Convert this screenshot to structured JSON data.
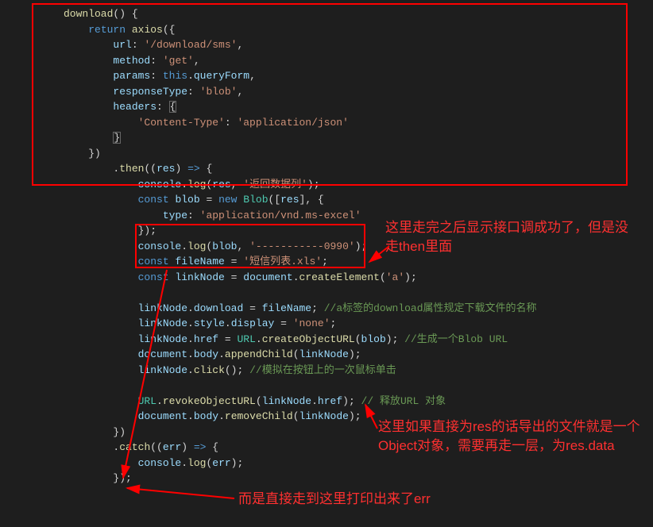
{
  "code": {
    "l1a": "download",
    "l1b": "() {",
    "l2a": "return",
    "l2b": "axios",
    "l2c": "({",
    "l3a": "url",
    "l3b": ": ",
    "l3c": "'/download/sms'",
    "l3d": ",",
    "l4a": "method",
    "l4b": ": ",
    "l4c": "'get'",
    "l4d": ",",
    "l5a": "params",
    "l5b": ": ",
    "l5c": "this",
    "l5d": ".",
    "l5e": "queryForm",
    "l5f": ",",
    "l6a": "responseType",
    "l6b": ": ",
    "l6c": "'blob'",
    "l6d": ",",
    "l7a": "headers",
    "l7b": ": ",
    "l7c": "{",
    "l8a": "'Content-Type'",
    "l8b": ": ",
    "l8c": "'application/json'",
    "l9a": "}",
    "l10a": "})",
    "l11a": ".",
    "l11b": "then",
    "l11c": "((",
    "l11d": "res",
    "l11e": ") ",
    "l11f": "=>",
    "l11g": " {",
    "l12a": "console",
    "l12b": ".",
    "l12c": "log",
    "l12d": "(",
    "l12e": "res",
    "l12f": ", ",
    "l12g": "'返回数据列'",
    "l12h": ");",
    "l13a": "const",
    "l13b": "blob",
    "l13c": " = ",
    "l13d": "new",
    "l13e": "Blob",
    "l13f": "([",
    "l13g": "res",
    "l13h": "], {",
    "l14a": "type",
    "l14b": ": ",
    "l14c": "'application/vnd.ms-excel'",
    "l15a": "});",
    "l16a": "console",
    "l16b": ".",
    "l16c": "log",
    "l16d": "(",
    "l16e": "blob",
    "l16f": ", ",
    "l16g": "'-----------0990'",
    "l16h": ");",
    "l17a": "const",
    "l17b": "fileName",
    "l17c": " = ",
    "l17d": "'短信列表.xls'",
    "l17e": ";",
    "l18a": "const",
    "l18b": "linkNode",
    "l18c": " = ",
    "l18d": "document",
    "l18e": ".",
    "l18f": "createElement",
    "l18g": "(",
    "l18h": "'a'",
    "l18i": ");",
    "l19a": "linkNode",
    "l19b": ".",
    "l19c": "download",
    "l19d": " = ",
    "l19e": "fileName",
    "l19f": "; ",
    "l19g": "//a标签的download属性规定下载文件的名称",
    "l20a": "linkNode",
    "l20b": ".",
    "l20c": "style",
    "l20d": ".",
    "l20e": "display",
    "l20f": " = ",
    "l20g": "'none'",
    "l20h": ";",
    "l21a": "linkNode",
    "l21b": ".",
    "l21c": "href",
    "l21d": " = ",
    "l21e": "URL",
    "l21f": ".",
    "l21g": "createObjectURL",
    "l21h": "(",
    "l21i": "blob",
    "l21j": "); ",
    "l21k": "//生成一个Blob URL",
    "l22a": "document",
    "l22b": ".",
    "l22c": "body",
    "l22d": ".",
    "l22e": "appendChild",
    "l22f": "(",
    "l22g": "linkNode",
    "l22h": ");",
    "l23a": "linkNode",
    "l23b": ".",
    "l23c": "click",
    "l23d": "(); ",
    "l23e": "//模拟在按钮上的一次鼠标单击",
    "l24a": "URL",
    "l24b": ".",
    "l24c": "revokeObjectURL",
    "l24d": "(",
    "l24e": "linkNode",
    "l24f": ".",
    "l24g": "href",
    "l24h": "); ",
    "l24i": "// 释放URL 对象",
    "l25a": "document",
    "l25b": ".",
    "l25c": "body",
    "l25d": ".",
    "l25e": "removeChild",
    "l25f": "(",
    "l25g": "linkNode",
    "l25h": ");",
    "l26a": "})",
    "l27a": ".",
    "l27b": "catch",
    "l27c": "((",
    "l27d": "err",
    "l27e": ") ",
    "l27f": "=>",
    "l27g": " {",
    "l28a": "console",
    "l28b": ".",
    "l28c": "log",
    "l28d": "(",
    "l28e": "err",
    "l28f": ");",
    "l29a": "});"
  },
  "annotations": {
    "a1": "这里走完之后显示接口调成功了，但是没走then里面",
    "a2": "这里如果直接为res的话导出的文件就是一个Object对象，需要再走一层，为res.data",
    "a3": "而是直接走到这里打印出来了err"
  }
}
